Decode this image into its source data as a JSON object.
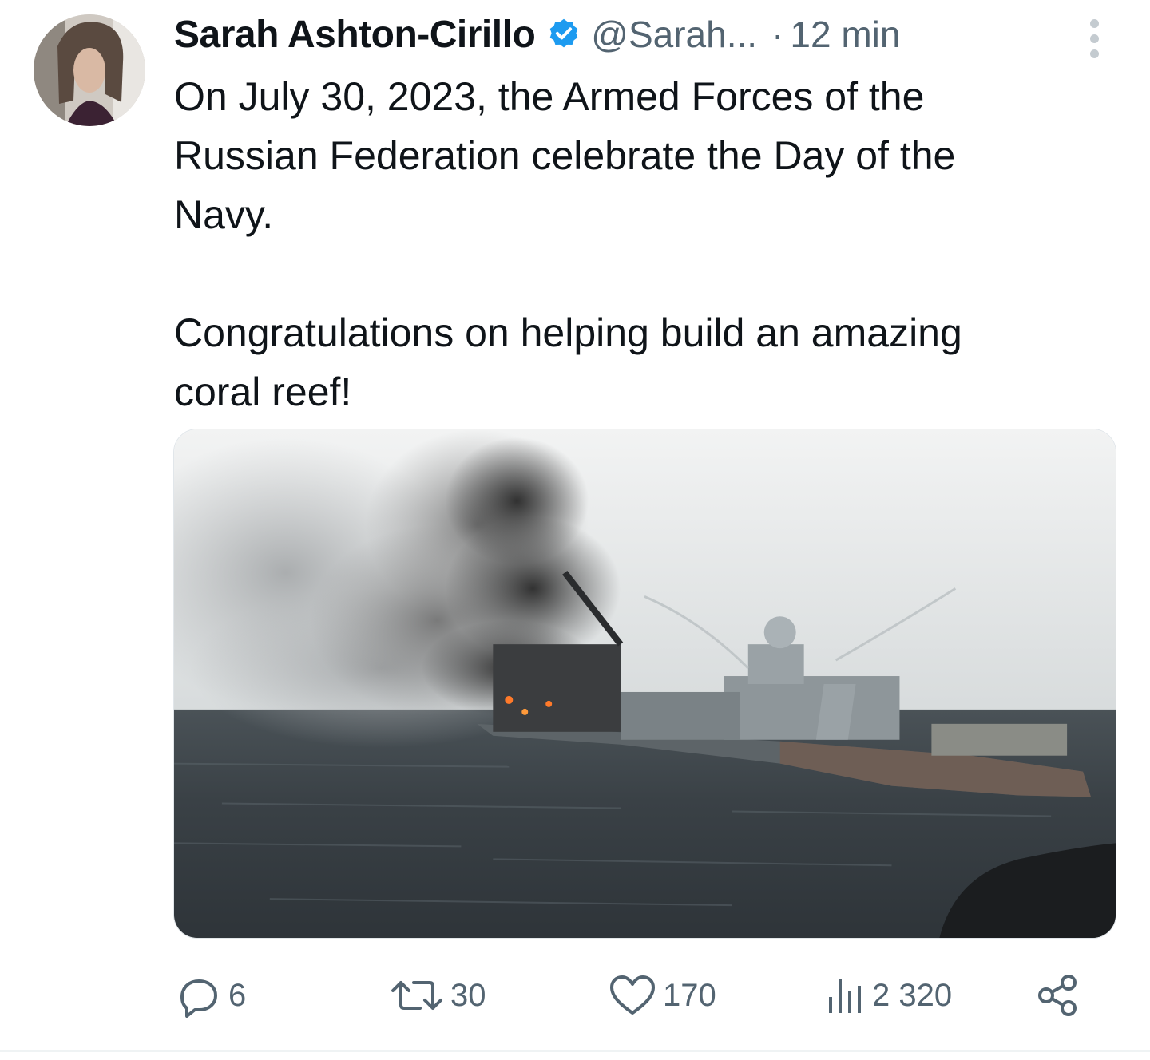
{
  "tweet": {
    "author": {
      "name": "Sarah Ashton-Cirillo",
      "handle": "@Sarah...",
      "verified": true,
      "verified_color": "#1d9bf0"
    },
    "separator": "·",
    "time": "12 min",
    "text": {
      "line1": "On July 30, 2023, the Armed Forces of the",
      "line2": "Russian Federation celebrate the Day of the",
      "line3": "Navy.",
      "line4": "Congratulations on helping build an amazing",
      "line5": "coral reef!"
    },
    "actions": {
      "replies": "6",
      "retweets": "30",
      "likes": "170",
      "views": "2 320"
    },
    "icons": {
      "more": "more-vertical-icon",
      "reply": "reply-icon",
      "retweet": "retweet-icon",
      "like": "heart-icon",
      "views": "views-icon",
      "share": "share-icon"
    },
    "colors": {
      "text": "#0f1419",
      "secondary": "#536471",
      "accent": "#1d9bf0"
    }
  }
}
